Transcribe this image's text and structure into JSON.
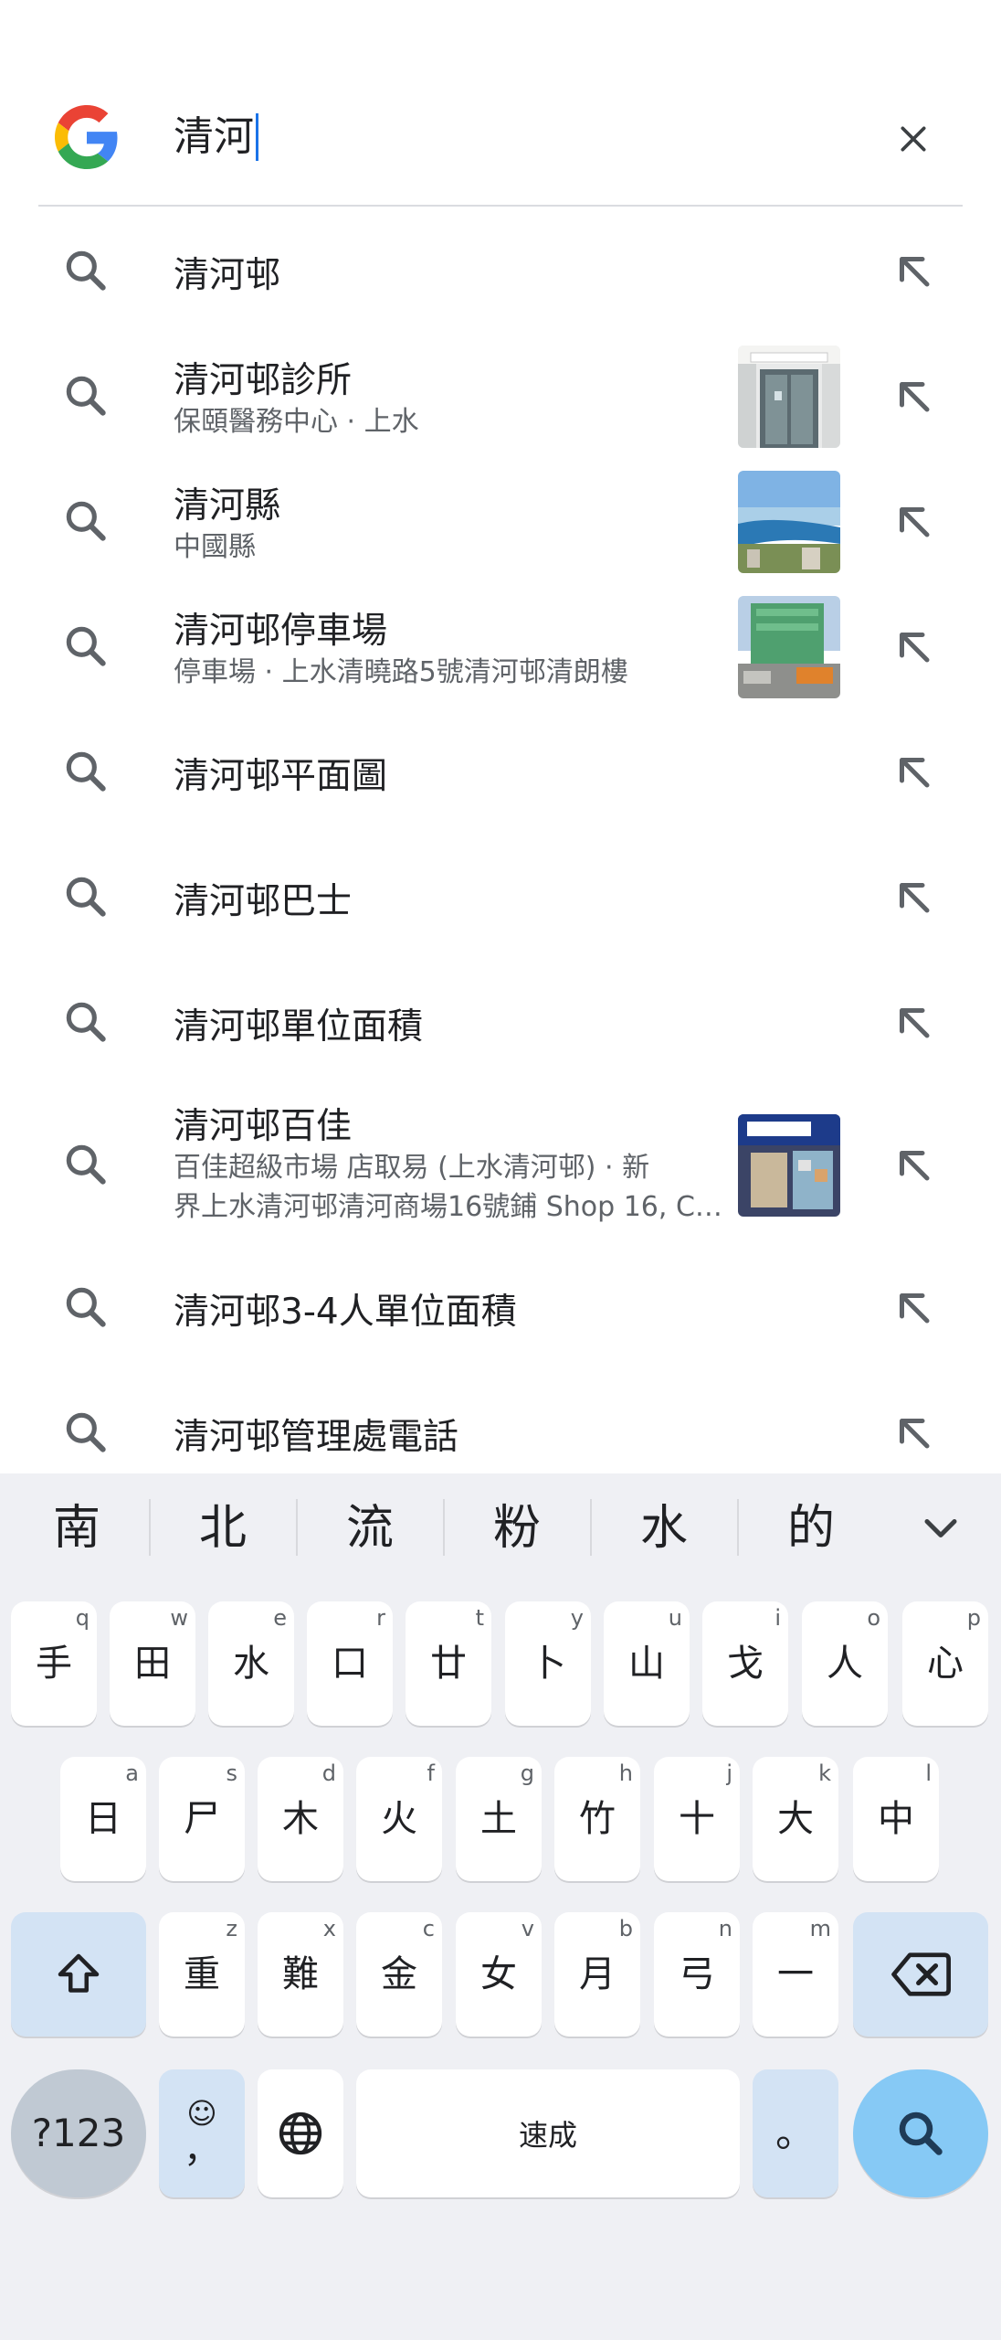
{
  "search": {
    "query": "清河",
    "logo_icon": "google-g-icon",
    "clear_icon": "close-icon"
  },
  "suggestions": [
    {
      "title": "清河邨",
      "subtitle": "",
      "has_thumb": false
    },
    {
      "title": "清河邨診所",
      "subtitle": "保頤醫務中心 · 上水",
      "has_thumb": true
    },
    {
      "title": "清河縣",
      "subtitle": "中國縣",
      "has_thumb": true
    },
    {
      "title": "清河邨停車場",
      "subtitle": "停車場 · 上水清曉路5號清河邨清朗樓",
      "has_thumb": true
    },
    {
      "title": "清河邨平面圖",
      "subtitle": "",
      "has_thumb": false
    },
    {
      "title": "清河邨巴士",
      "subtitle": "",
      "has_thumb": false
    },
    {
      "title": "清河邨單位面積",
      "subtitle": "",
      "has_thumb": false
    },
    {
      "title": "清河邨百佳",
      "subtitle": "百佳超級市場 店取易 (上水清河邨) · 新",
      "subtitle2": "界上水清河邨清河商場16號鋪 Shop 16, C…",
      "has_thumb": true
    },
    {
      "title": "清河邨3-4人單位面積",
      "subtitle": "",
      "has_thumb": false
    },
    {
      "title": "清河邨管理處電話",
      "subtitle": "",
      "has_thumb": false
    }
  ],
  "keyboard": {
    "candidates": [
      "南",
      "北",
      "流",
      "粉",
      "水",
      "的"
    ],
    "row1": [
      {
        "char": "手",
        "hint": "q"
      },
      {
        "char": "田",
        "hint": "w"
      },
      {
        "char": "水",
        "hint": "e"
      },
      {
        "char": "口",
        "hint": "r"
      },
      {
        "char": "廿",
        "hint": "t"
      },
      {
        "char": "卜",
        "hint": "y"
      },
      {
        "char": "山",
        "hint": "u"
      },
      {
        "char": "戈",
        "hint": "i"
      },
      {
        "char": "人",
        "hint": "o"
      },
      {
        "char": "心",
        "hint": "p"
      }
    ],
    "row2": [
      {
        "char": "日",
        "hint": "a"
      },
      {
        "char": "尸",
        "hint": "s"
      },
      {
        "char": "木",
        "hint": "d"
      },
      {
        "char": "火",
        "hint": "f"
      },
      {
        "char": "土",
        "hint": "g"
      },
      {
        "char": "竹",
        "hint": "h"
      },
      {
        "char": "十",
        "hint": "j"
      },
      {
        "char": "大",
        "hint": "k"
      },
      {
        "char": "中",
        "hint": "l"
      }
    ],
    "row3": [
      {
        "char": "重",
        "hint": "z"
      },
      {
        "char": "難",
        "hint": "x"
      },
      {
        "char": "金",
        "hint": "c"
      },
      {
        "char": "女",
        "hint": "v"
      },
      {
        "char": "月",
        "hint": "b"
      },
      {
        "char": "弓",
        "hint": "n"
      },
      {
        "char": "一",
        "hint": "m"
      }
    ],
    "sym_label": "?123",
    "comma_label": "，",
    "emoji_label": "☺",
    "space_label": "速成",
    "period_label": "。",
    "shift_icon": "shift-icon",
    "backspace_icon": "backspace-icon",
    "globe_icon": "globe-icon",
    "search_key_icon": "search-icon"
  }
}
